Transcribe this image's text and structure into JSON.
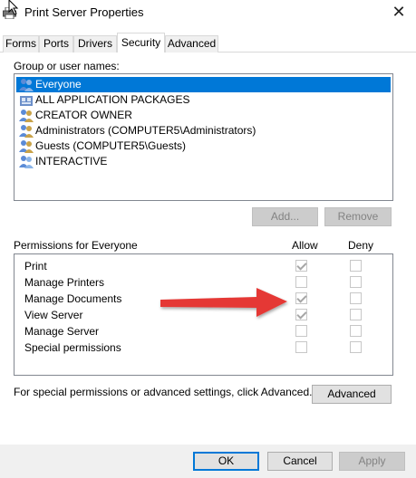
{
  "window": {
    "title": "Print Server Properties",
    "close_glyph": "✕"
  },
  "tabs": [
    {
      "label": "Forms",
      "active": false
    },
    {
      "label": "Ports",
      "active": false
    },
    {
      "label": "Drivers",
      "active": false
    },
    {
      "label": "Security",
      "active": true
    },
    {
      "label": "Advanced",
      "active": false
    }
  ],
  "security": {
    "group_label": "Group or user names:",
    "users": [
      {
        "name": "Everyone",
        "selected": true
      },
      {
        "name": "ALL APPLICATION PACKAGES",
        "selected": false
      },
      {
        "name": "CREATOR OWNER",
        "selected": false
      },
      {
        "name": "Administrators (COMPUTER5\\Administrators)",
        "selected": false
      },
      {
        "name": "Guests (COMPUTER5\\Guests)",
        "selected": false
      },
      {
        "name": "INTERACTIVE",
        "selected": false
      }
    ],
    "add_label": "Add...",
    "remove_label": "Remove",
    "permissions_label": "Permissions for Everyone",
    "allow_header": "Allow",
    "deny_header": "Deny",
    "permissions": [
      {
        "name": "Print",
        "allow": true,
        "deny": false
      },
      {
        "name": "Manage Printers",
        "allow": false,
        "deny": false
      },
      {
        "name": "Manage Documents",
        "allow": true,
        "deny": false
      },
      {
        "name": "View Server",
        "allow": true,
        "deny": false
      },
      {
        "name": "Manage Server",
        "allow": false,
        "deny": false
      },
      {
        "name": "Special permissions",
        "allow": false,
        "deny": false
      }
    ],
    "special_note": "For special permissions or advanced settings, click Advanced.",
    "advanced_label": "Advanced"
  },
  "footer": {
    "ok_label": "OK",
    "cancel_label": "Cancel",
    "apply_label": "Apply"
  },
  "colors": {
    "selection": "#0078d7",
    "arrow": "#e53935"
  }
}
